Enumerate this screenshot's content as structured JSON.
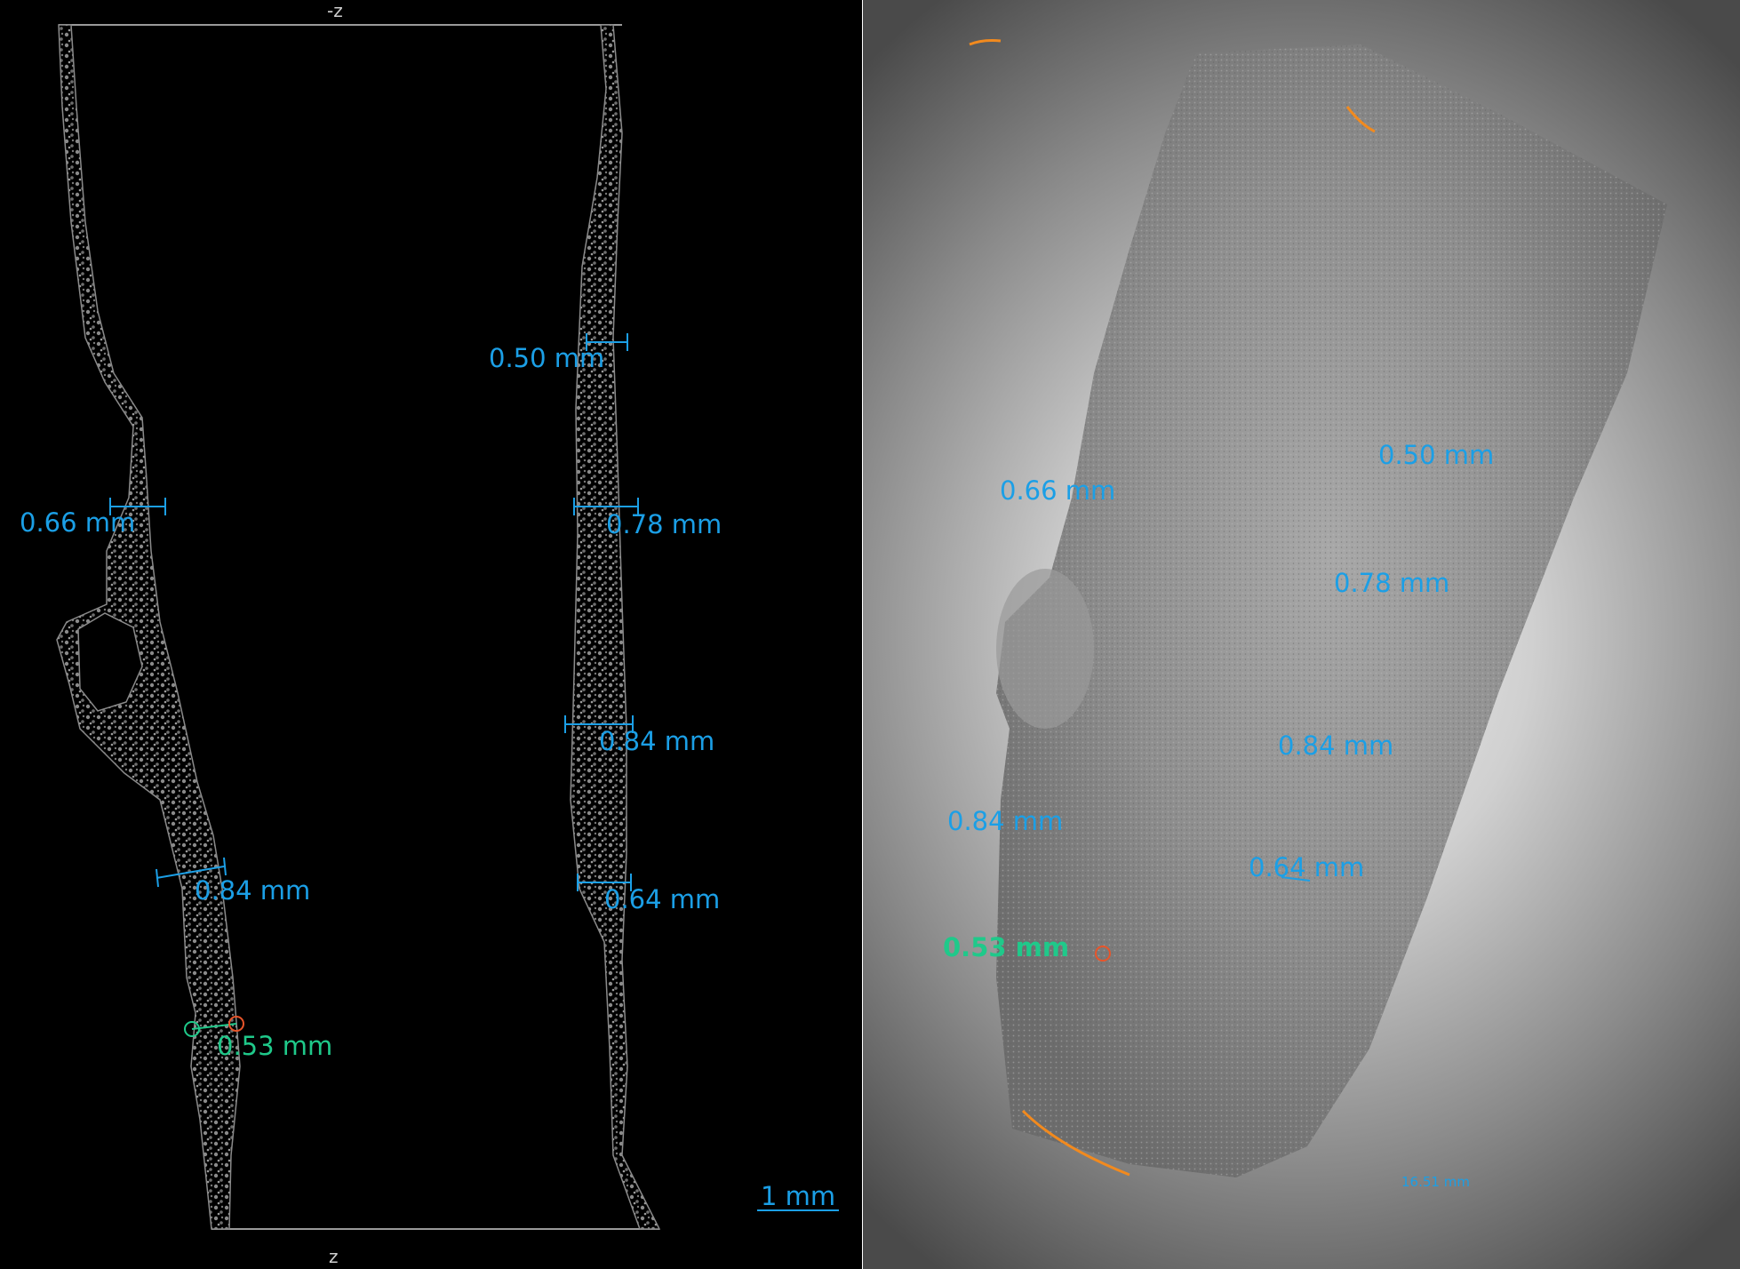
{
  "left_view": {
    "axis_top": "-z",
    "axis_bottom": "z",
    "scale_bar": "1 mm",
    "measurements": [
      "0.50 mm",
      "0.66 mm",
      "0.78 mm",
      "0.84 mm",
      "0.84 mm",
      "0.64 mm",
      "0.53 mm"
    ]
  },
  "right_view": {
    "measurements": [
      "0.66 mm",
      "0.50 mm",
      "0.78 mm",
      "0.84 mm",
      "0.84 mm",
      "0.64 mm",
      "0.53 mm"
    ],
    "scale_text": "16.51 mm"
  },
  "colors": {
    "measurement": "#1b9fe6",
    "selected_measurement": "#1fc98a",
    "marker": "#e8552a",
    "arc": "#f28a1e"
  }
}
